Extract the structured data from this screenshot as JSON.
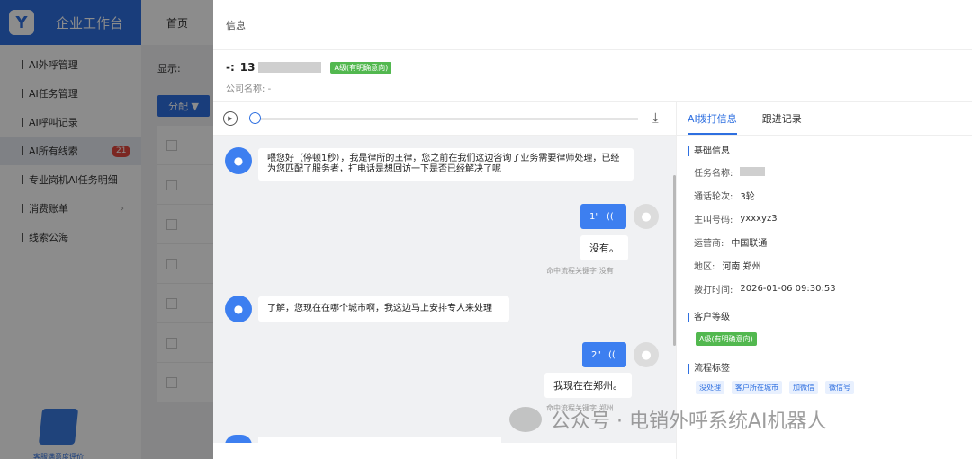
{
  "app": {
    "logo_letter": "Y",
    "title": "企业工作台",
    "nav_home": "首页"
  },
  "sidebar": {
    "items": [
      {
        "label": "AI外呼管理"
      },
      {
        "label": "AI任务管理"
      },
      {
        "label": "AI呼叫记录"
      },
      {
        "label": "AI所有线索",
        "badge": "21"
      },
      {
        "label": "专业岗机AI任务明细"
      },
      {
        "label": "消费账单"
      },
      {
        "label": "线索公海"
      }
    ],
    "feedback_label": "客服满意度评价"
  },
  "background_main": {
    "filter_label": "显示:",
    "assign_button": "分配 ▼"
  },
  "drawer": {
    "header": "信息",
    "phone_prefix": "-:",
    "phone": "13",
    "level_tag": "A级(有明确意向)",
    "company_label": "公司名称:",
    "company_value": "-"
  },
  "chat": {
    "messages": [
      {
        "role": "bot",
        "text": "喂您好（停顿1秒），我是律所的王律，您之前在我们这边咨询了业务需要律师处理，已经为您匹配了服务者，打电话是想回访一下是否已经解决了呢"
      },
      {
        "role": "user",
        "voice": "1\"",
        "text": "没有。",
        "hint": "命中流程关键字:没有"
      },
      {
        "role": "bot",
        "text": "了解，您现在在哪个城市啊，我这边马上安排专人来处理"
      },
      {
        "role": "user",
        "voice": "2\"",
        "text": "我现在在郑州。",
        "hint": "命中流程关键字:郑州"
      }
    ]
  },
  "details": {
    "tabs": [
      "AI拨打信息",
      "跟进记录"
    ],
    "basic_title": "基础信息",
    "fields": [
      {
        "label": "任务名称:",
        "value": ""
      },
      {
        "label": "通话轮次:",
        "value": "3轮"
      },
      {
        "label": "主叫号码:",
        "value": "yxxxyz3"
      },
      {
        "label": "运营商:",
        "value": "中国联通"
      },
      {
        "label": "地区:",
        "value": "河南 郑州"
      },
      {
        "label": "拨打时间:",
        "value": "2026-01-06 09:30:53"
      }
    ],
    "level_title": "客户等级",
    "level_value": "A级(有明确意向)",
    "flow_title": "流程标签",
    "flow_tags": [
      "没处理",
      "客户所在城市",
      "加微信",
      "微信号"
    ]
  },
  "watermark": "公众号 · 电销外呼系统AI机器人"
}
